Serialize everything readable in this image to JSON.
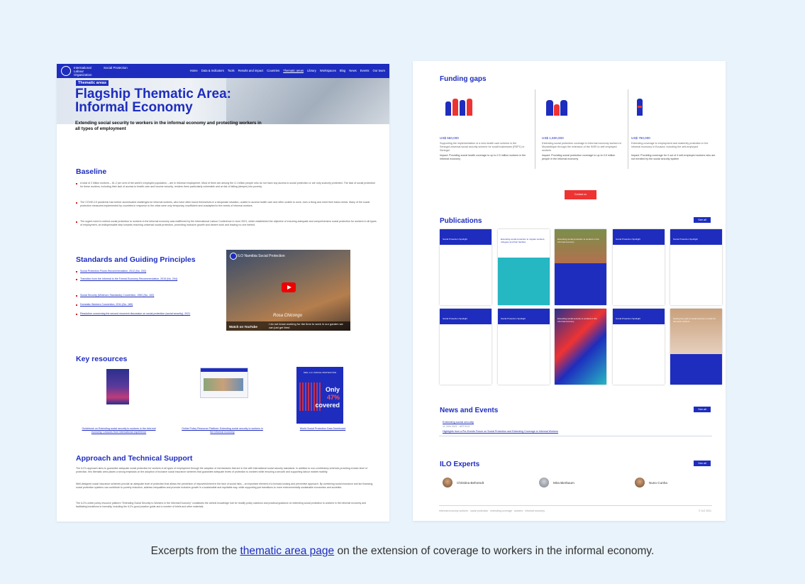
{
  "left_page": {
    "nav": {
      "org": "International Labour Organization",
      "dept": "Social Protection",
      "menu": [
        "Home",
        "Data & Indicators",
        "Tools",
        "Results and impact",
        "Countries",
        "Thematic areas",
        "Library",
        "Workspaces",
        "Blog",
        "News",
        "Events",
        "Our team"
      ]
    },
    "tag": "Thematic areas",
    "title": "Flagship Thematic Area: Informal Economy",
    "subtitle": "Extending social security to workers in the informal economy and protecting workers in all types of employment",
    "baseline": {
      "heading": "Baseline",
      "bullets": [
        "A total of 2 billion workers – 61.2 per cent of the world's employed population – are in informal employment. Most of them are among the 4.1 billion people who do not have any access to social protection or are only scarcely protected. The lack of social protection for these workers, including their lack of access to health care and income security, renders them particularly vulnerable and at risk of falling (deeper) into poverty.",
        "The COVID-19 pandemic has further accentuated challenges for informal workers, who have often found themselves in a desperate situation, unable to access health care and often unable to work, earn a living and meet their basic needs. Many of the social protection measures implemented by countries in response to the crisis were only temporary, insufficient and unadapted to the needs of informal workers.",
        "The urgent need to extend social protection to workers in the informal economy was reaffirmed by the International Labour Conference in June 2021, which established the objective of ensuring adequate and comprehensive social protection for workers in all types of employment, an indispensable step towards reaching universal social protection, promoting inclusive growth and decent work and leaving no one behind."
      ]
    },
    "standards": {
      "heading": "Standards and Guiding Principles",
      "links": [
        "Social Protection Floors Recommendation, 2012 (No. 202)",
        "Transition from the Informal to the Formal Economy Recommendation, 2015 (No. 204)",
        "Social Security (Minimum Standards) Convention, 1952 (No. 102)",
        "Domestic Workers Convention, 2011 (No. 189)",
        "Resolution concerning the second recurrent discussion on social protection (social security), 2021"
      ]
    },
    "video": {
      "title": "ILO Namibia Social Protection",
      "person": "Rosa Chicongo",
      "watch_on": "Watch on YouTube",
      "caption": "I do not know working for the time to work in our garden we can just get tired"
    },
    "key_resources": {
      "heading": "Key resources",
      "items": [
        {
          "label": "Guidebook on Extending social security to workers in the informal economy: Lessons from international experience"
        },
        {
          "label": "Online Policy Resource Platform: Extending social security to workers in the informal economy"
        },
        {
          "label": "World Social Protection Data Dashboard",
          "cover_text": [
            "Only",
            "47%",
            "covered"
          ],
          "cover_header": "SDG 1.3.1 SOCIAL PROTECTION"
        }
      ]
    },
    "approach": {
      "heading": "Approach and Technical Support",
      "paragraphs": [
        "The ILO's approach aims to guarantee adequate social protection for workers in all types of employment through the adoption of mechanisms that are in line with international social security standards. In addition to non-contributory schemes providing a basic level of protection, this thematic area places a strong emphasis on the adoption of inclusive social insurance schemes that guarantee adequate levels of protection to workers while ensuring a smooth and supporting labour market mobility.",
        "Well-designed social insurance schemes provide an adequate level of protection that allows the prevention of impoverishment in the face of social risks – an important element of a forward-looking and preventive approach. By combining social insurance and tax financing, social protection systems can contribute to poverty reduction, address inequalities and promote inclusive growth in a sustainable and equitable way, while supporting just transitions to more environmentally sustainable economies and societies.",
        "The ILO's online policy resource platform \"Extending Social Security to Workers in the Informal Economy\" constitutes the central knowledge hub for readily policy solutions and practical guidance on extending social protection to workers in the informal economy and facilitating transitions to formality, including the ILO's good practice guide and a number of briefs and other materials."
      ]
    }
  },
  "right_page": {
    "funding": {
      "heading": "Funding gaps",
      "items": [
        {
          "amount": "US$ 550,000",
          "text": "Supporting the implementation of a new health care scheme in the Senegal universal social security scheme for small businesses (RSPC) in Senegal",
          "impact": "Impact: Providing social health coverage to up to 2.5 million workers in the informal economy"
        },
        {
          "amount": "US$ 1,500,000",
          "text": "Extending social protection coverage to informal economy workers in Mozambique through the extension of the INSS to self-employed workers",
          "impact": "Impact: Providing social protection coverage to up to 0.5 million people in the informal economy"
        },
        {
          "amount": "US$ 750,000",
          "text": "Extending coverage to employment and maternity protection in the informal economy in Ecuador, including the self-employed",
          "impact": "Impact: Providing coverage for 3 out of 4 self-employed workers who are not enrolled by the social security system"
        }
      ],
      "cta": "Contact us"
    },
    "publications": {
      "heading": "Publications",
      "see_all": "See all",
      "cover_titles": [
        "Social Protection Spotlight",
        "Extending social protection to migrant workers, refugees and their families",
        "Extending social protection to workers in the informal economy",
        "Social Protection Spotlight",
        "Social Protection Spotlight",
        "Social Protection Spotlight",
        "Social Protection Spotlight",
        "Extending social security to workers in the informal economy",
        "Social Protection Spotlight",
        "Getting the right to social security in reach for domestic workers"
      ]
    },
    "news": {
      "heading": "News and Events",
      "see_all": "See all",
      "item_title": "Extending social security",
      "item_meta": "11 JUN 2021 · ARTICLE",
      "item_link": "Highlights from a Pre-Events Forum on Social Protection and Extending Coverage to Informal Workers"
    },
    "experts": {
      "heading": "ILO Experts",
      "see_all": "See all",
      "names": [
        "Christina Behrendt",
        "Mira Bierbaum",
        "Nuno Cunha"
      ]
    },
    "footer": {
      "tags": "informal economy workers · social protection · extending coverage · workers · informal economy",
      "right": "© ILO 2021"
    }
  },
  "caption": {
    "before": "Excerpts from the ",
    "link": "thematic area page",
    "after": " on the extension of coverage to workers in the informal economy."
  },
  "colors": {
    "ilo_blue": "#1e2dbe",
    "accent_red": "#e33333",
    "background": "#e9f3fb"
  }
}
